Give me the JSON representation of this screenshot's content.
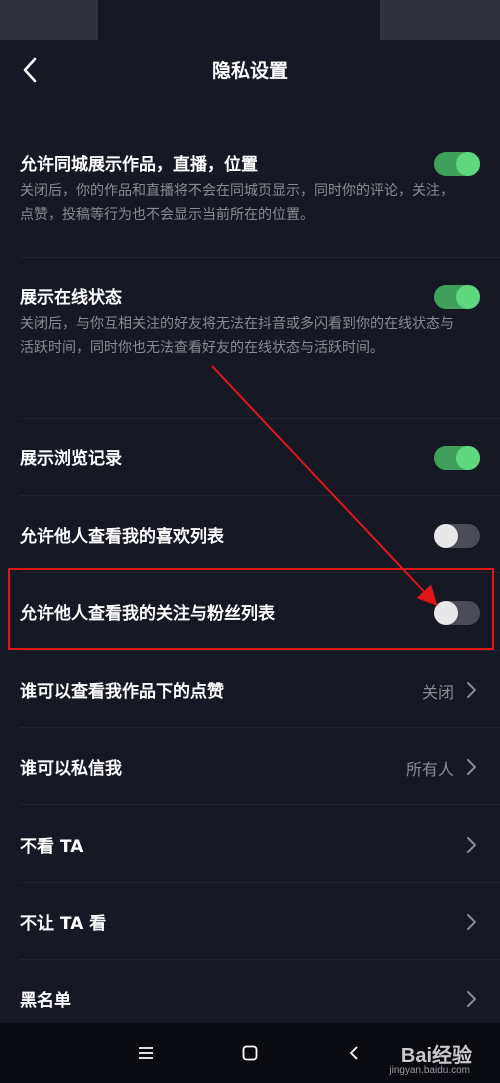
{
  "header": {
    "title": "隐私设置",
    "back_icon": "chevron-left-icon"
  },
  "settings": [
    {
      "title": "允许同城展示作品，直播，位置",
      "desc": "关闭后，你的作品和直播将不会在同城页显示，同时你的评论，关注，点赞，投稿等行为也不会显示当前所在的位置。",
      "toggle": "on"
    },
    {
      "title": "展示在线状态",
      "desc": "关闭后，与你互相关注的好友将无法在抖音或多闪看到你的在线状态与活跃时间，同时你也无法查看好友的在线状态与活跃时间。",
      "toggle": "on"
    },
    {
      "title": "展示浏览记录",
      "toggle": "on"
    },
    {
      "title": "允许他人查看我的喜欢列表",
      "toggle": "off"
    },
    {
      "title": "允许他人查看我的关注与粉丝列表",
      "toggle": "off"
    },
    {
      "title": "谁可以查看我作品下的点赞",
      "value": "关闭"
    },
    {
      "title": "谁可以私信我",
      "value": "所有人"
    },
    {
      "title": "不看 TA"
    },
    {
      "title": "不让 TA 看"
    },
    {
      "title": "黑名单"
    }
  ],
  "annotation": {
    "color": "#e0161b"
  },
  "colors": {
    "background": "#161823",
    "toggle_on": "#5fd77f",
    "secondary_text": "#8a8b91"
  },
  "nav_bar": {
    "icons": [
      "menu-icon",
      "home-square-icon",
      "back-triangle-icon"
    ]
  },
  "watermark": {
    "text": "Bai经验",
    "sub": "jingyan.baidu.com"
  }
}
